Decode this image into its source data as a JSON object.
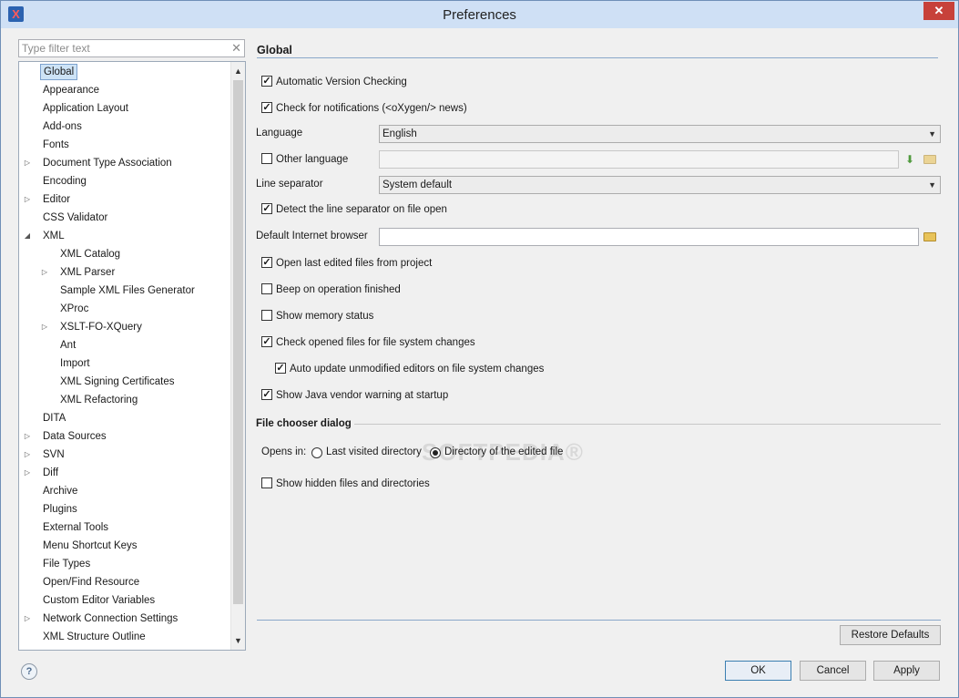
{
  "window": {
    "title": "Preferences",
    "close": "✕"
  },
  "filter": {
    "placeholder": "Type filter text",
    "clear": "✕"
  },
  "tree": [
    {
      "label": "Global"
    },
    {
      "label": "Appearance"
    },
    {
      "label": "Application Layout"
    },
    {
      "label": "Add-ons"
    },
    {
      "label": "Fonts"
    },
    {
      "label": "Document Type Association",
      "expandable": true
    },
    {
      "label": "Encoding"
    },
    {
      "label": "Editor",
      "expandable": true
    },
    {
      "label": "CSS Validator"
    },
    {
      "label": "XML",
      "expanded": true
    },
    {
      "label": "XML Catalog"
    },
    {
      "label": "XML Parser",
      "expandable": true
    },
    {
      "label": "Sample XML Files Generator"
    },
    {
      "label": "XProc"
    },
    {
      "label": "XSLT-FO-XQuery",
      "expandable": true
    },
    {
      "label": "Ant"
    },
    {
      "label": "Import"
    },
    {
      "label": "XML Signing Certificates"
    },
    {
      "label": "XML Refactoring"
    },
    {
      "label": "DITA"
    },
    {
      "label": "Data Sources",
      "expandable": true
    },
    {
      "label": "SVN",
      "expandable": true
    },
    {
      "label": "Diff",
      "expandable": true
    },
    {
      "label": "Archive"
    },
    {
      "label": "Plugins"
    },
    {
      "label": "External Tools"
    },
    {
      "label": "Menu Shortcut Keys"
    },
    {
      "label": "File Types"
    },
    {
      "label": "Open/Find Resource"
    },
    {
      "label": "Custom Editor Variables"
    },
    {
      "label": "Network Connection Settings",
      "expandable": true
    },
    {
      "label": "XML Structure Outline"
    }
  ],
  "panel": {
    "title": "Global",
    "auto_version": {
      "label": "Automatic Version Checking",
      "checked": true
    },
    "notifications": {
      "label": "Check for notifications (<oXygen/> news)",
      "checked": true
    },
    "language": {
      "label": "Language",
      "value": "English"
    },
    "other_language": {
      "label": "Other language",
      "checked": false,
      "value": ""
    },
    "line_separator": {
      "label": "Line separator",
      "value": "System default"
    },
    "detect_separator": {
      "label": "Detect the line separator on file open",
      "checked": true
    },
    "browser": {
      "label": "Default Internet browser",
      "value": ""
    },
    "open_last": {
      "label": "Open last edited files from project",
      "checked": true
    },
    "beep": {
      "label": "Beep on operation finished",
      "checked": false
    },
    "memory": {
      "label": "Show memory status",
      "checked": false
    },
    "check_changes": {
      "label": "Check opened files for file system changes",
      "checked": true
    },
    "auto_update": {
      "label": "Auto update unmodified editors on file system changes",
      "checked": true
    },
    "java_warning": {
      "label": "Show Java vendor warning at startup",
      "checked": true
    },
    "file_chooser": {
      "title": "File chooser dialog",
      "opens_in": "Opens in:",
      "option_last": "Last visited directory",
      "option_edited": "Directory of the edited file",
      "selected": "edited",
      "hidden": {
        "label": "Show hidden files and directories",
        "checked": false
      }
    },
    "restore": "Restore Defaults"
  },
  "buttons": {
    "ok": "OK",
    "cancel": "Cancel",
    "apply": "Apply"
  },
  "help": "?",
  "watermark": "SOFTPEDIA®",
  "icons": {
    "download": "download-icon",
    "folder": "folder-icon"
  }
}
